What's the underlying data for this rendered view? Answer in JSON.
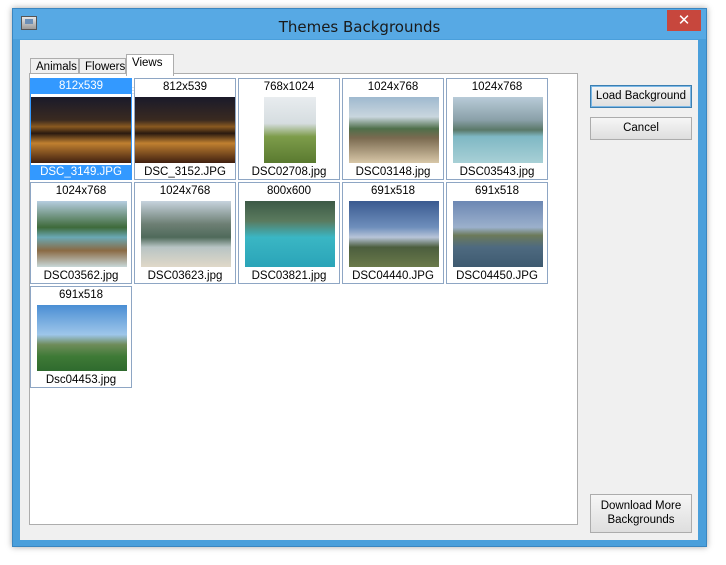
{
  "window": {
    "title": "Themes Backgrounds",
    "close_glyph": "✕"
  },
  "tabs": [
    {
      "label": "Animals",
      "active": false
    },
    {
      "label": "Flowers",
      "active": false
    },
    {
      "label": "Views",
      "active": true
    }
  ],
  "thumbnails": [
    {
      "size": "812x539",
      "name": "DSC_3149.JPG",
      "selected": true,
      "scene": "night-city"
    },
    {
      "size": "812x539",
      "name": "DSC_3152.JPG",
      "selected": false,
      "scene": "night-city"
    },
    {
      "size": "768x1024",
      "name": "DSC02708.jpg",
      "selected": false,
      "scene": "tree-field"
    },
    {
      "size": "1024x768",
      "name": "DSC03148.jpg",
      "selected": false,
      "scene": "beach-huts"
    },
    {
      "size": "1024x768",
      "name": "DSC03543.jpg",
      "selected": false,
      "scene": "bay-boats"
    },
    {
      "size": "1024x768",
      "name": "DSC03562.jpg",
      "selected": false,
      "scene": "longtail-boat"
    },
    {
      "size": "1024x768",
      "name": "DSC03623.jpg",
      "selected": false,
      "scene": "beach-cliffs"
    },
    {
      "size": "800x600",
      "name": "DSC03821.jpg",
      "selected": false,
      "scene": "lagoon"
    },
    {
      "size": "691x518",
      "name": "DSC04440.JPG",
      "selected": false,
      "scene": "mountain-plain"
    },
    {
      "size": "691x518",
      "name": "DSC04450.JPG",
      "selected": false,
      "scene": "lake-reeds"
    },
    {
      "size": "691x518",
      "name": "Dsc04453.jpg",
      "selected": false,
      "scene": "green-meadow"
    }
  ],
  "buttons": {
    "load": "Load Background",
    "cancel": "Cancel",
    "download": "Download More Backgrounds"
  },
  "colors": {
    "selection": "#3399ff",
    "title_bar": "#57a9e4",
    "close": "#c7473d"
  }
}
